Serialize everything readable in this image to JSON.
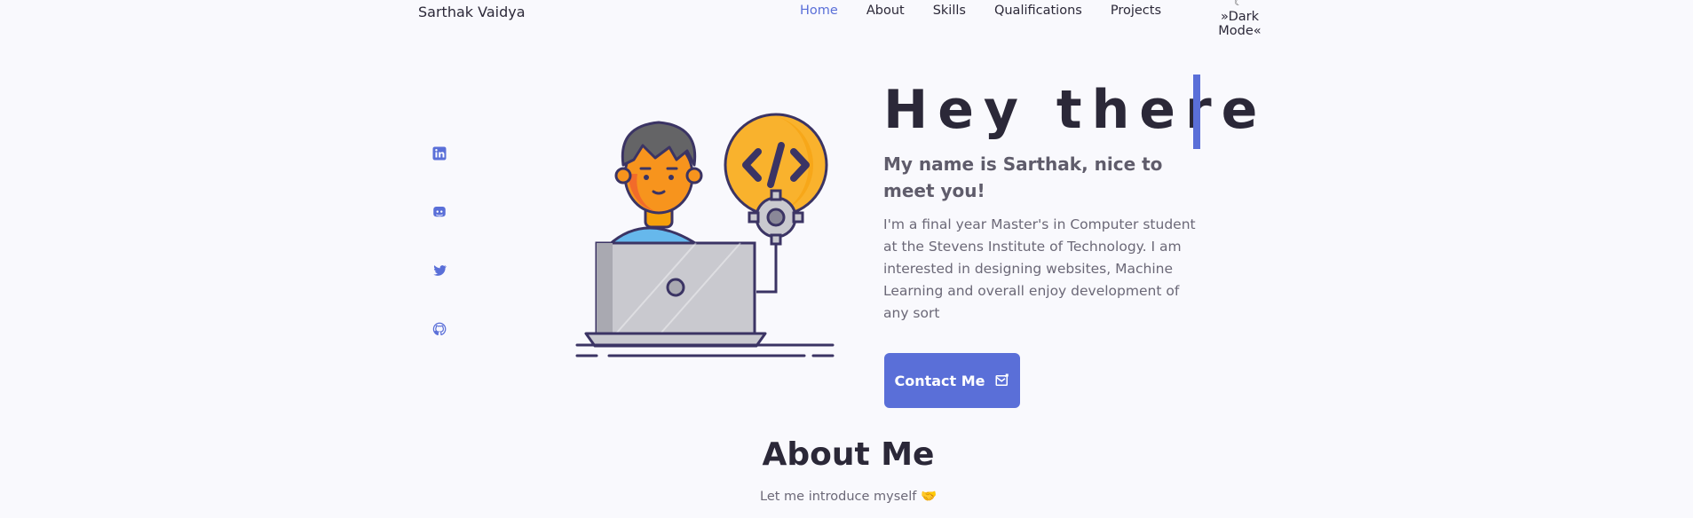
{
  "header": {
    "brand": "Sarthak Vaidya",
    "nav": [
      {
        "label": "Home",
        "active": true
      },
      {
        "label": "About",
        "active": false
      },
      {
        "label": "Skills",
        "active": false
      },
      {
        "label": "Qualifications",
        "active": false
      },
      {
        "label": "Projects",
        "active": false
      }
    ],
    "theme_toggle": {
      "label": "»Dark Mode«",
      "icon": "moon-icon"
    }
  },
  "social": [
    {
      "name": "linkedin",
      "icon": "linkedin-icon"
    },
    {
      "name": "discord",
      "icon": "discord-icon"
    },
    {
      "name": "twitter",
      "icon": "twitter-icon"
    },
    {
      "name": "github",
      "icon": "github-icon"
    }
  ],
  "hero": {
    "title": "Hey there",
    "subtitle": "My name is Sarthak, nice to meet you!",
    "description": "I'm a final year Master's in Computer student at the Stevens Institute of Technology. I am interested in designing websites, Machine Learning and overall enjoy development of any sort",
    "contact_label": "Contact Me",
    "contact_icon": "mail-icon"
  },
  "about": {
    "title": "About Me",
    "subtitle": "Let me introduce myself",
    "emoji": "🤝"
  },
  "colors": {
    "accent": "#5a6fd8",
    "background": "#f9f9fd",
    "text": "#2b2838"
  }
}
